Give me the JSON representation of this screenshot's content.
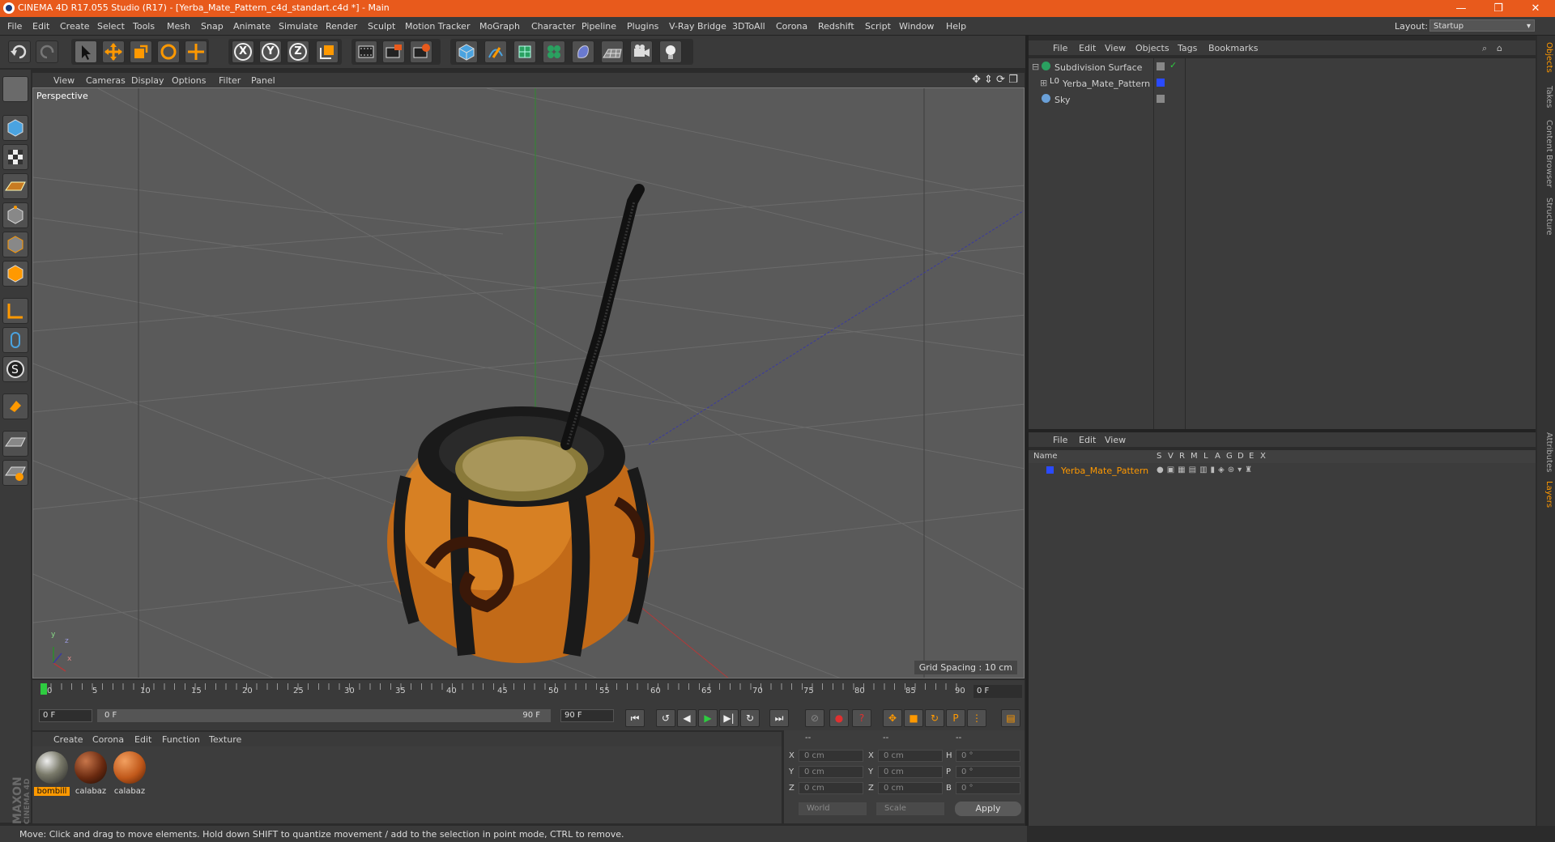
{
  "window": {
    "title": "CINEMA 4D R17.055 Studio (R17) - [Yerba_Mate_Pattern_c4d_standart.c4d *] - Main",
    "controls": [
      "—",
      "❐",
      "✕"
    ]
  },
  "menubar": {
    "items": [
      "File",
      "Edit",
      "Create",
      "Select",
      "Tools",
      "Mesh",
      "Snap",
      "Animate",
      "Simulate",
      "Render",
      "Sculpt",
      "Motion Tracker",
      "MoGraph",
      "Character",
      "Pipeline",
      "Plugins",
      "V-Ray Bridge",
      "3DToAll",
      "Corona",
      "Redshift",
      "Script",
      "Window",
      "Help"
    ],
    "layout_label": "Layout:",
    "layout_value": "Startup"
  },
  "toolbar": {
    "icons": [
      "undo-icon",
      "redo-icon",
      "select-icon",
      "move-icon",
      "scale-icon",
      "rotate-icon",
      "live-select-icon",
      "x-axis-icon",
      "y-axis-icon",
      "z-axis-icon",
      "coordinate-system-icon",
      "render-view-icon",
      "render-picture-viewer-icon",
      "edit-render-settings-icon",
      "cube-icon",
      "pen-icon",
      "subdivision-icon",
      "cloner-icon",
      "deformer-icon",
      "floor-icon",
      "camera-icon",
      "light-icon"
    ],
    "axis_labels": [
      "X",
      "Y",
      "Z"
    ]
  },
  "viewport": {
    "menu": [
      "View",
      "Cameras",
      "Display",
      "Options",
      "Filter",
      "Panel"
    ],
    "label": "Perspective",
    "grid_spacing": "Grid Spacing : 10 cm",
    "axis_gizmo": {
      "y": "y",
      "z": "z",
      "x": "x"
    }
  },
  "timeline": {
    "ticks": [
      "0",
      "5",
      "10",
      "15",
      "20",
      "25",
      "30",
      "35",
      "40",
      "45",
      "50",
      "55",
      "60",
      "65",
      "70",
      "75",
      "80",
      "85",
      "90"
    ],
    "current_frame": "0 F"
  },
  "transport": {
    "start_field": "0 F",
    "range_start": "0 F",
    "range_end": "90 F",
    "end_field": "90 F"
  },
  "material_manager": {
    "menu": [
      "Create",
      "Corona",
      "Edit",
      "Function",
      "Texture"
    ],
    "materials": [
      {
        "name": "bombill",
        "color": "#7a7a6a",
        "selected": true
      },
      {
        "name": "calabaz",
        "color": "#6a2a10",
        "selected": false
      },
      {
        "name": "calabaz",
        "color": "#c0581a",
        "selected": false
      }
    ]
  },
  "coordinates": {
    "headers": [
      "--",
      "--",
      "--"
    ],
    "rows": [
      {
        "a": "X",
        "av": "0 cm",
        "b": "X",
        "bv": "0 cm",
        "c": "H",
        "cv": "0 °"
      },
      {
        "a": "Y",
        "av": "0 cm",
        "b": "Y",
        "bv": "0 cm",
        "c": "P",
        "cv": "0 °"
      },
      {
        "a": "Z",
        "av": "0 cm",
        "b": "Z",
        "bv": "0 cm",
        "c": "B",
        "cv": "0 °"
      }
    ],
    "mode": "World",
    "transform": "Scale",
    "apply": "Apply"
  },
  "statusbar": {
    "text": "Move: Click and drag to move elements. Hold down SHIFT to quantize movement / add to the selection in point mode, CTRL to remove."
  },
  "branding": {
    "logo": "MAXON CINEMA 4D"
  },
  "object_manager": {
    "menu": [
      "File",
      "Edit",
      "View",
      "Objects",
      "Tags",
      "Bookmarks"
    ],
    "objects": [
      {
        "name": "Subdivision Surface",
        "color": "#d0d0d0"
      },
      {
        "name": "Yerba_Mate_Pattern",
        "color": "#d0d0d0"
      },
      {
        "name": "Sky",
        "color": "#d0d0d0"
      }
    ]
  },
  "layer_manager": {
    "menu": [
      "File",
      "Edit",
      "View"
    ],
    "headers": [
      "Name",
      "S",
      "V",
      "R",
      "M",
      "L",
      "A",
      "G",
      "D",
      "E",
      "X"
    ],
    "layers": [
      {
        "name": "Yerba_Mate_Pattern",
        "color": "#ff9900"
      }
    ]
  },
  "right_tabs": [
    "Objects",
    "Takes",
    "Content Browser",
    "Structure",
    "Attributes",
    "Layers"
  ],
  "colors": {
    "accent": "#e85a1c",
    "selection": "#ff9900"
  }
}
